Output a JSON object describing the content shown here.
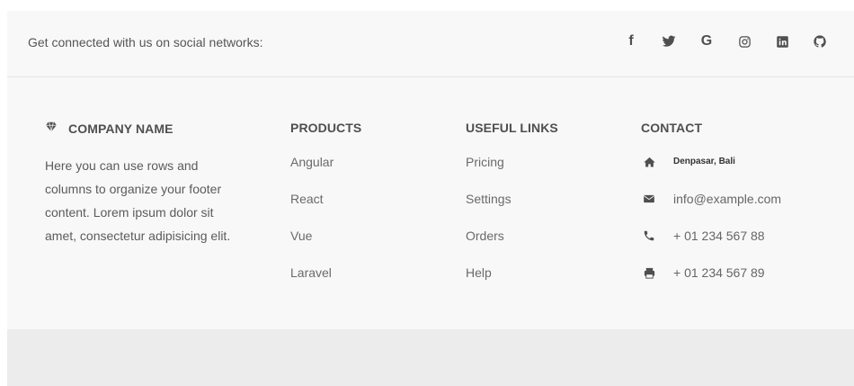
{
  "social": {
    "text": "Get connected with us on social networks:",
    "icons": [
      {
        "name": "facebook",
        "glyph": "f"
      },
      {
        "name": "twitter",
        "glyph": "🐦"
      },
      {
        "name": "google",
        "glyph": "G"
      },
      {
        "name": "instagram",
        "glyph": "◎"
      },
      {
        "name": "linkedin",
        "glyph": "in"
      },
      {
        "name": "github",
        "glyph": "⌂"
      }
    ]
  },
  "company": {
    "title": "COMPANY NAME",
    "description": "Here you can use rows and columns to organize your footer content. Lorem ipsum dolor sit amet, consectetur adipisicing elit."
  },
  "products": {
    "title": "PRODUCTS",
    "items": [
      "Angular",
      "React",
      "Vue",
      "Laravel"
    ]
  },
  "useful_links": {
    "title": "USEFUL LINKS",
    "items": [
      "Pricing",
      "Settings",
      "Orders",
      "Help"
    ]
  },
  "contact": {
    "title": "CONTACT",
    "address": "Denpasar, Bali",
    "email": "info@example.com",
    "phone": "+ 01 234 567 88",
    "fax": "+ 01 234 567 89"
  },
  "colors": {
    "text": "#4f4f4f",
    "background": "#f8f8f8",
    "bottom": "#ececec"
  }
}
